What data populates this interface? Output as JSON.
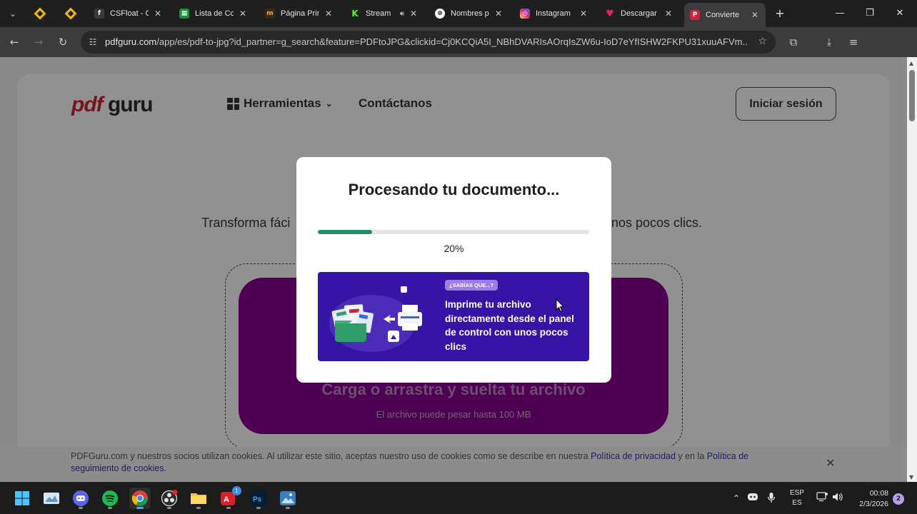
{
  "browser": {
    "tabs": [
      {
        "title": "CSFloat - C",
        "color": "#3a3a3a",
        "glyph": "f"
      },
      {
        "title": "Lista de Co",
        "color": "#1e8e3e",
        "glyph": "▦"
      },
      {
        "title": "Página Prin",
        "color": "#3a2a1a",
        "glyph": "m"
      },
      {
        "title": "Stream",
        "color": "#53fc18",
        "glyph": "K"
      },
      {
        "title": "Nombres p",
        "color": "#ffffff",
        "glyph": "⊛"
      },
      {
        "title": "Instagram",
        "color": "#d62976",
        "glyph": "◎"
      },
      {
        "title": "Descargar",
        "color": "#e0245e",
        "glyph": "♥"
      },
      {
        "title": "Convierte",
        "color": "#d0213d",
        "glyph": "P"
      }
    ],
    "url_host": "pdfguru.com",
    "url_path": "/app/es/pdf-to-jpg?id_partner=g_search&feature=PDFtoJPG&clickid=Cj0KCQiA5I_NBhDVARIsAOrqIsZW6u-IoD7eYfISHW2FKPU31xuuAFVm..."
  },
  "site": {
    "logo_pdf": "pdf",
    "logo_guru": "guru",
    "nav_tools": "Herramientas",
    "nav_contact": "Contáctanos",
    "login": "Iniciar sesión",
    "subtitle_left": "Transforma fáci",
    "subtitle_right": "nos pocos clics.",
    "upload_title": "Carga o arrastra y suelta tu archivo",
    "upload_sub": "El archivo puede pesar hasta 100 MB",
    "cookie": {
      "text1": "PDFGuru.com y nuestros socios utilizan cookies. Al utilizar este sitio, aceptas nuestro uso de cookies como se describe en nuestra ",
      "link1": "Política de privacidad",
      "text2": " y en la ",
      "link2": "Política de seguimiento de cookies",
      "text3": "."
    }
  },
  "modal": {
    "title": "Procesando tu documento...",
    "progress": 0.2,
    "progress_label": "20%",
    "progress_color": "#258c6b",
    "banner_badge": "¿SABÍAS QUE...?",
    "banner_text": "Imprime tu archivo directamente desde el panel de control con unos pocos clics",
    "banner_color": "#3614a6"
  },
  "taskbar": {
    "lang_top": "ESP",
    "lang_bottom": "ES",
    "time": "00:08",
    "date": "2/3/2026",
    "notifications": "2",
    "adobe_badge": "1"
  }
}
